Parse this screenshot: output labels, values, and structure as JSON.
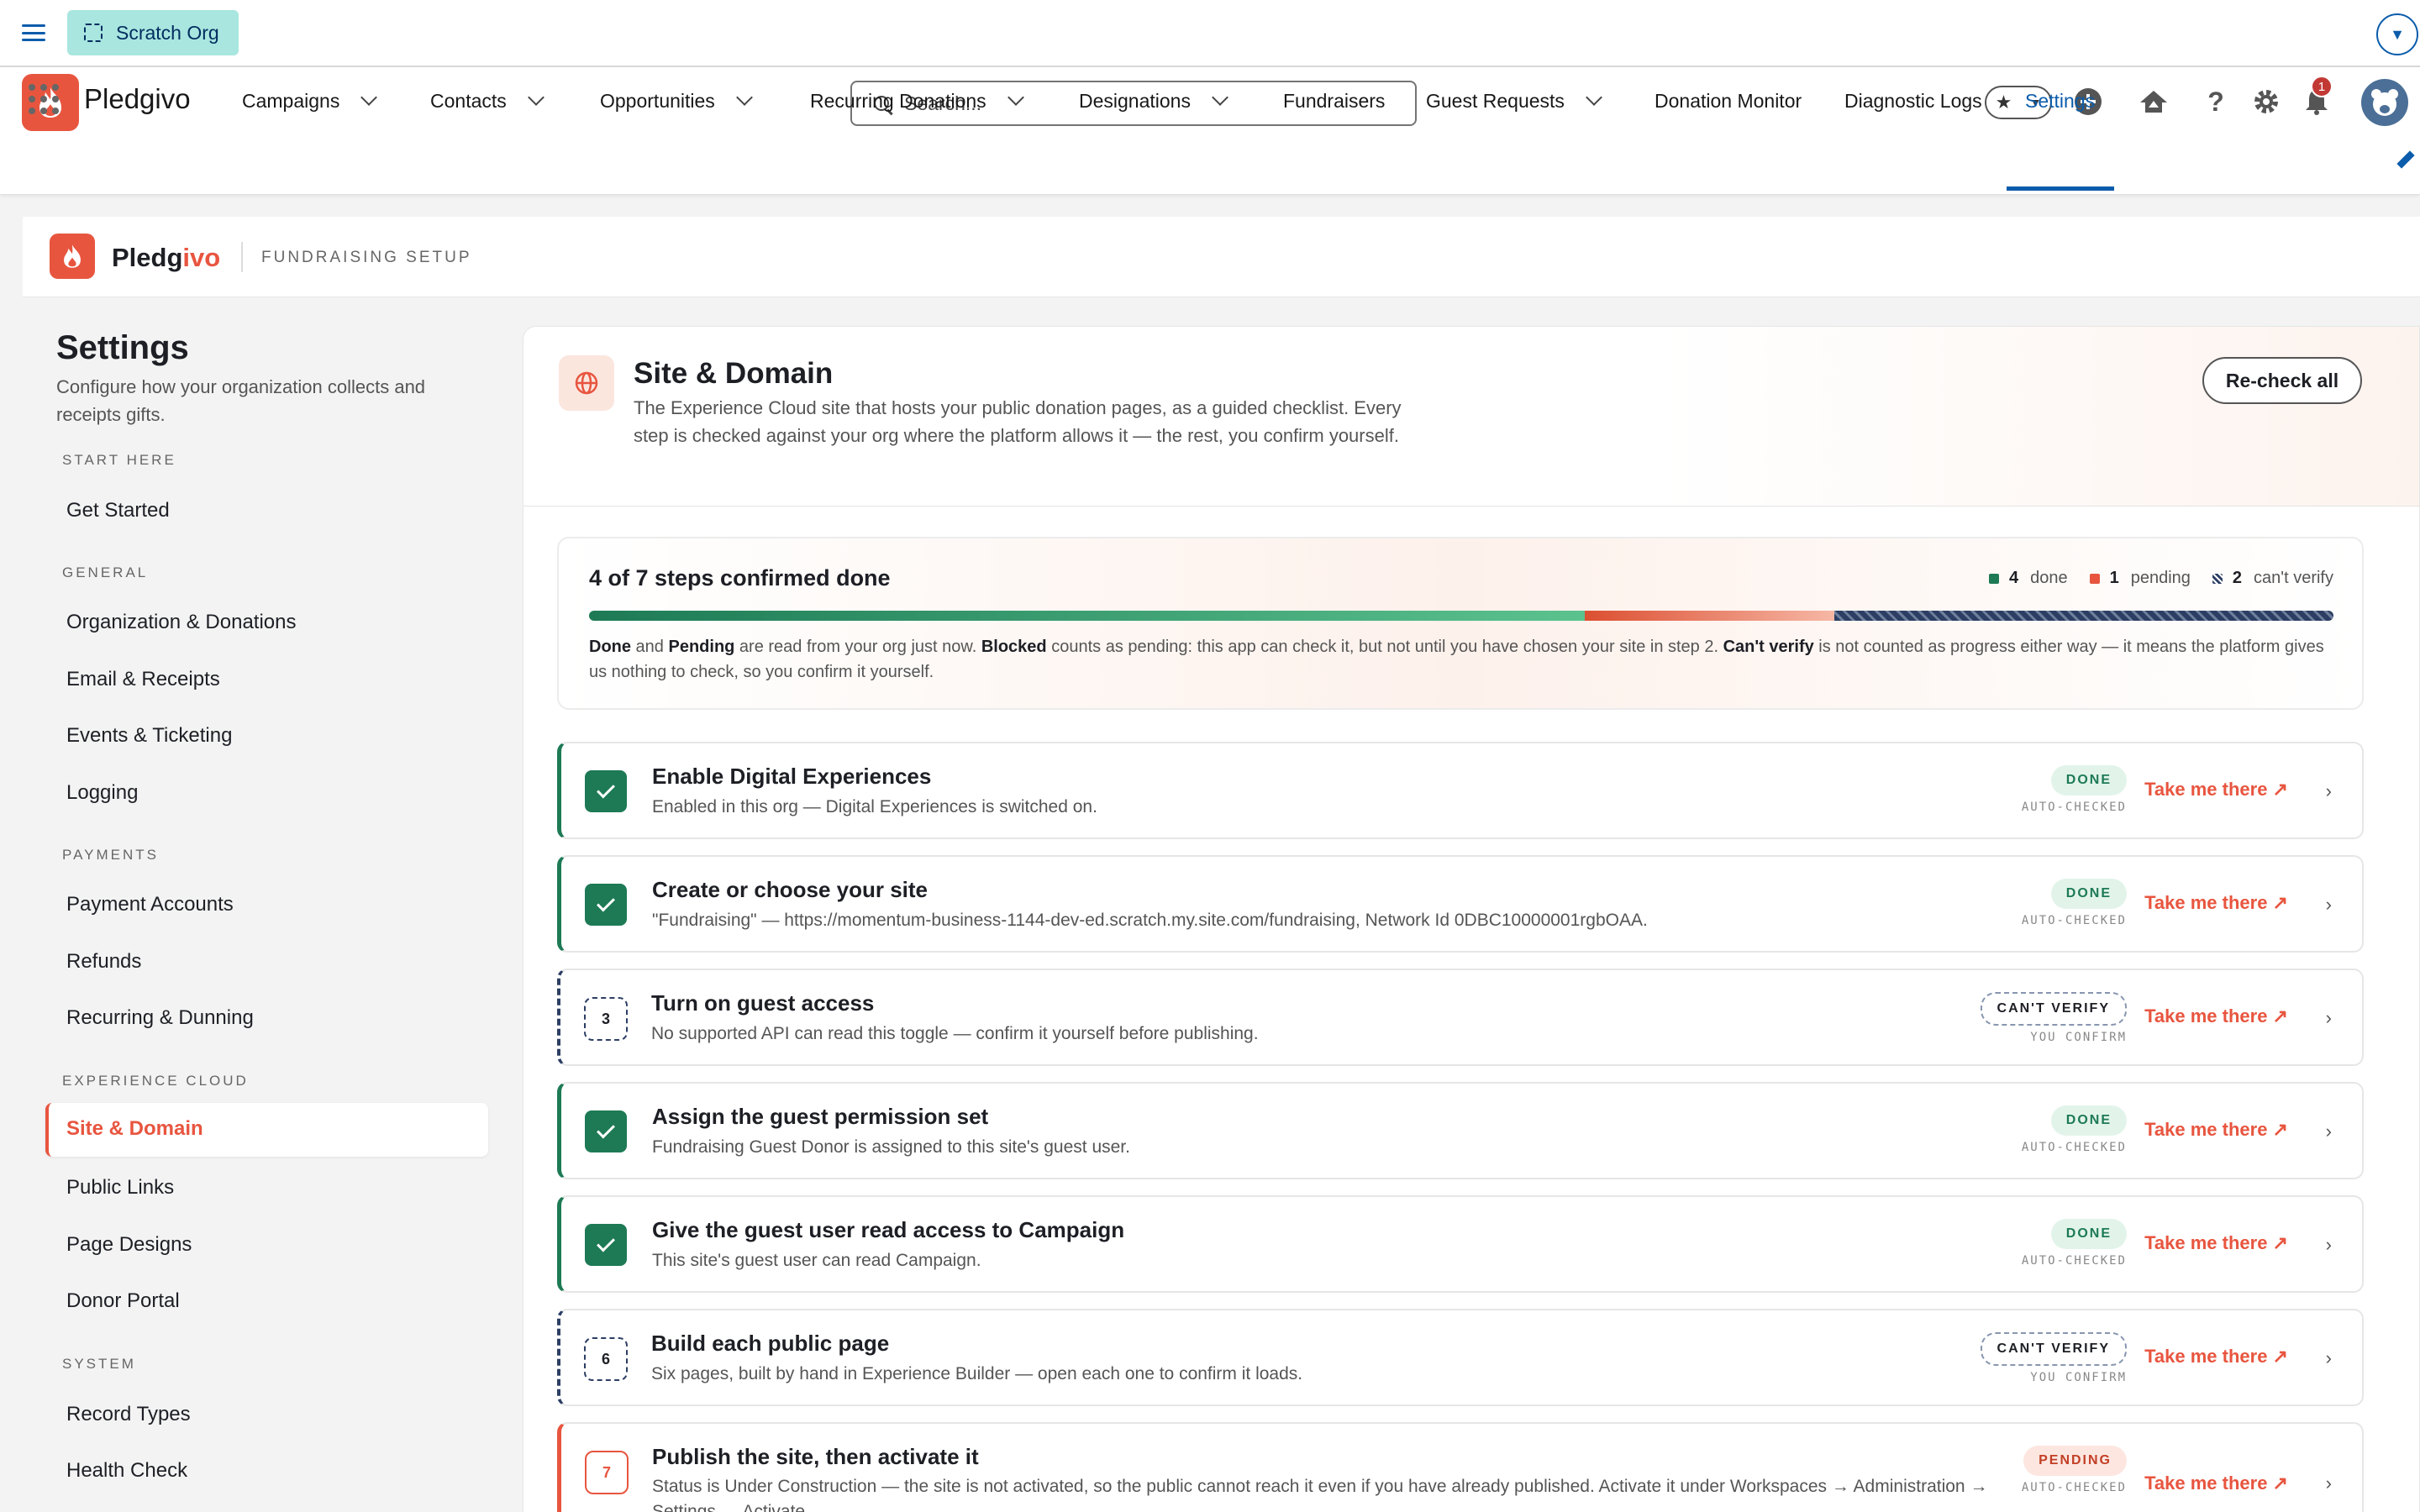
{
  "topbar": {
    "org_label": "Scratch Org"
  },
  "header": {
    "search_placeholder": "Search...",
    "notification_count": "1",
    "app_name": "Pledgivo"
  },
  "nav": [
    {
      "label": "Campaigns",
      "dropdown": true
    },
    {
      "label": "Contacts",
      "dropdown": true
    },
    {
      "label": "Opportunities",
      "dropdown": true
    },
    {
      "label": "Recurring Donations",
      "dropdown": true
    },
    {
      "label": "Designations",
      "dropdown": true
    },
    {
      "label": "Fundraisers",
      "dropdown": false
    },
    {
      "label": "Guest Requests",
      "dropdown": true
    },
    {
      "label": "Donation Monitor",
      "dropdown": false
    },
    {
      "label": "Diagnostic Logs",
      "dropdown": false
    },
    {
      "label": "Settings",
      "dropdown": false,
      "active": true
    }
  ],
  "brand": {
    "name_a": "Pledg",
    "name_b": "ivo",
    "subtitle": "FUNDRAISING SETUP"
  },
  "sidebar": {
    "title": "Settings",
    "description": "Configure how your organization collects and receipts gifts.",
    "sections": [
      {
        "label": "START HERE",
        "items": [
          "Get Started"
        ]
      },
      {
        "label": "GENERAL",
        "items": [
          "Organization & Donations",
          "Email & Receipts",
          "Events & Ticketing",
          "Logging"
        ]
      },
      {
        "label": "PAYMENTS",
        "items": [
          "Payment Accounts",
          "Refunds",
          "Recurring & Dunning"
        ]
      },
      {
        "label": "EXPERIENCE CLOUD",
        "items": [
          "Site & Domain",
          "Public Links",
          "Page Designs",
          "Donor Portal"
        ]
      },
      {
        "label": "SYSTEM",
        "items": [
          "Record Types",
          "Health Check"
        ]
      }
    ],
    "active_item": "Site & Domain"
  },
  "panel": {
    "title": "Site & Domain",
    "description": "The Experience Cloud site that hosts your public donation pages, as a guided checklist. Every step is checked against your org where the platform allows it — the rest, you confirm yourself.",
    "recheck_label": "Re-check all"
  },
  "progress": {
    "title": "4 of 7 steps confirmed done",
    "done_count": "4",
    "done_label": "done",
    "pending_count": "1",
    "pending_label": "pending",
    "cant_count": "2",
    "cant_label": "can't verify",
    "done_fraction": 0.571,
    "pending_fraction": 0.143,
    "cant_fraction": 0.286,
    "note_parts": {
      "b1": "Done",
      "t1": " and ",
      "b2": "Pending",
      "t2": " are read from your org just now. ",
      "b3": "Blocked",
      "t3": " counts as pending: this app can check it, but not until you have chosen your site in step 2. ",
      "b4": "Can't verify",
      "t4": " is not counted as progress either way — it means the platform gives us nothing to check, so you confirm it yourself."
    },
    "colors": {
      "done": "#1d7a55",
      "pending": "#e8553f",
      "cant": "#2c3e63"
    }
  },
  "steps": [
    {
      "num": "1",
      "state": "done",
      "title": "Enable Digital Experiences",
      "desc": "Enabled in this org — Digital Experiences is switched on.",
      "badge": "DONE",
      "sub": "AUTO-CHECKED",
      "link": "Take me there ↗"
    },
    {
      "num": "2",
      "state": "done",
      "title": "Create or choose your site",
      "desc": "\"Fundraising\" — https://momentum-business-1144-dev-ed.scratch.my.site.com/fundraising, Network Id 0DBC10000001rgbOAA.",
      "badge": "DONE",
      "sub": "AUTO-CHECKED",
      "link": "Take me there ↗"
    },
    {
      "num": "3",
      "state": "cv",
      "title": "Turn on guest access",
      "desc": "No supported API can read this toggle — confirm it yourself before publishing.",
      "badge": "CAN'T VERIFY",
      "sub": "YOU CONFIRM",
      "link": "Take me there ↗"
    },
    {
      "num": "4",
      "state": "done",
      "title": "Assign the guest permission set",
      "desc": "Fundraising Guest Donor is assigned to this site's guest user.",
      "badge": "DONE",
      "sub": "AUTO-CHECKED",
      "link": "Take me there ↗"
    },
    {
      "num": "5",
      "state": "done",
      "title": "Give the guest user read access to Campaign",
      "desc": "This site's guest user can read Campaign.",
      "badge": "DONE",
      "sub": "AUTO-CHECKED",
      "link": "Take me there ↗"
    },
    {
      "num": "6",
      "state": "cv",
      "title": "Build each public page",
      "desc": "Six pages, built by hand in Experience Builder — open each one to confirm it loads.",
      "badge": "CAN'T VERIFY",
      "sub": "YOU CONFIRM",
      "link": "Take me there ↗"
    },
    {
      "num": "7",
      "state": "pend",
      "title": "Publish the site, then activate it",
      "desc": "Status is Under Construction — the site is not activated, so the public cannot reach it even if you have already published. Activate it under Workspaces → Administration → Settings → Activate.",
      "badge": "PENDING",
      "sub": "AUTO-CHECKED",
      "link": "Take me there ↗"
    }
  ]
}
